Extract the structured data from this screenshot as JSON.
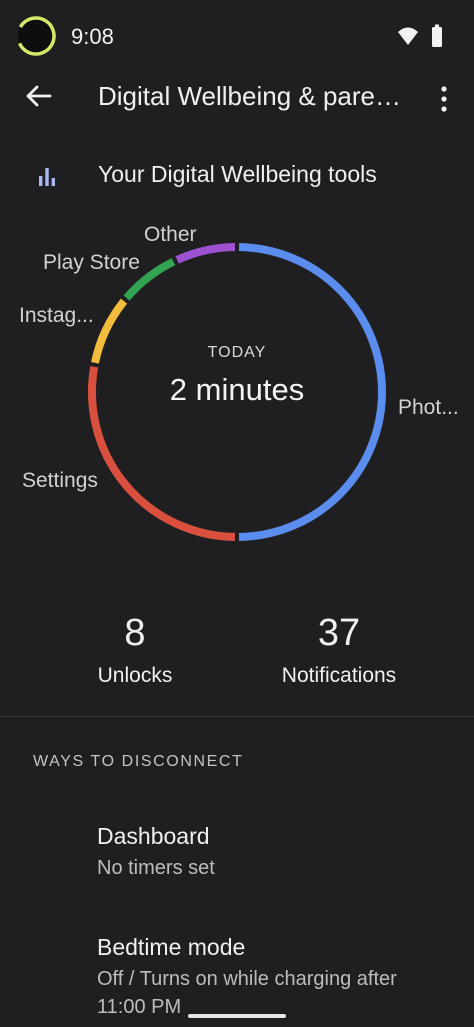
{
  "status_bar": {
    "time": "9:08",
    "icons": [
      "activity-ring-icon",
      "wifi-icon",
      "battery-icon"
    ]
  },
  "top_bar": {
    "title": "Digital Wellbeing & parental controls",
    "back_icon": "arrow-back-icon",
    "more_icon": "more-vert-icon"
  },
  "tools_row": {
    "icon": "bar-chart-icon",
    "label": "Your Digital Wellbeing tools"
  },
  "usage_chart": {
    "center_caption": "TODAY",
    "center_value": "2 minutes"
  },
  "chart_data": {
    "type": "pie",
    "categories": [
      "Phot...",
      "Settings",
      "Instag...",
      "Play Store",
      "Other"
    ],
    "values": [
      50,
      28,
      8,
      7,
      7
    ],
    "colors": [
      "#5b8def",
      "#d9503f",
      "#f2bd3c",
      "#32a350",
      "#9b51d0"
    ],
    "legend": "none"
  },
  "stats": {
    "unlocks_value": "8",
    "unlocks_label": "Unlocks",
    "notifications_value": "37",
    "notifications_label": "Notifications"
  },
  "section": {
    "header": "WAYS TO DISCONNECT",
    "items": [
      {
        "title": "Dashboard",
        "subtitle": "No timers set"
      },
      {
        "title": "Bedtime mode",
        "subtitle": "Off / Turns on while charging after 11:00 PM"
      }
    ]
  },
  "colors": {
    "background": "#1f1f21",
    "text": "#f0f0f2",
    "secondary_text": "#bdbdc1",
    "accent": "#aab8f5"
  }
}
